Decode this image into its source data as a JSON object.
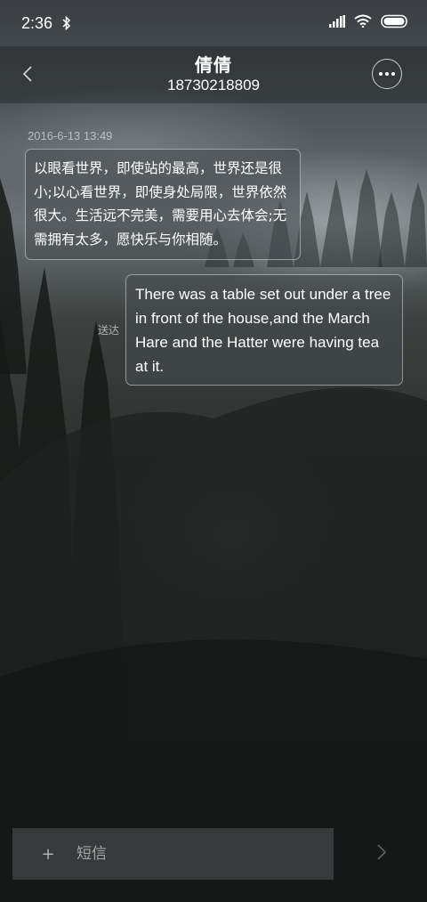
{
  "status_bar": {
    "time": "2:36"
  },
  "header": {
    "contact_name": "倩倩",
    "contact_number": "18730218809"
  },
  "conversation": {
    "timestamp": "2016-6-13 13:49",
    "messages": [
      {
        "direction": "incoming",
        "text": "以眼看世界，即使站的最高，世界还是很小;以心看世界，即使身处局限，世界依然很大。生活远不完美，需要用心去体会;无需拥有太多，愿快乐与你相随。"
      },
      {
        "direction": "outgoing",
        "status": "送达",
        "text": "There was a table set out under a tree in front of the house,and the March Hare and the Hatter were having tea at it."
      }
    ]
  },
  "composer": {
    "add_label": "+",
    "placeholder": "短信"
  },
  "icons": {
    "back": "chevron-left-icon",
    "more": "more-dots-icon",
    "send": "chevron-right-icon",
    "bluetooth": "bluetooth-icon",
    "signal": "signal-icon",
    "wifi": "wifi-icon",
    "battery": "battery-icon"
  }
}
